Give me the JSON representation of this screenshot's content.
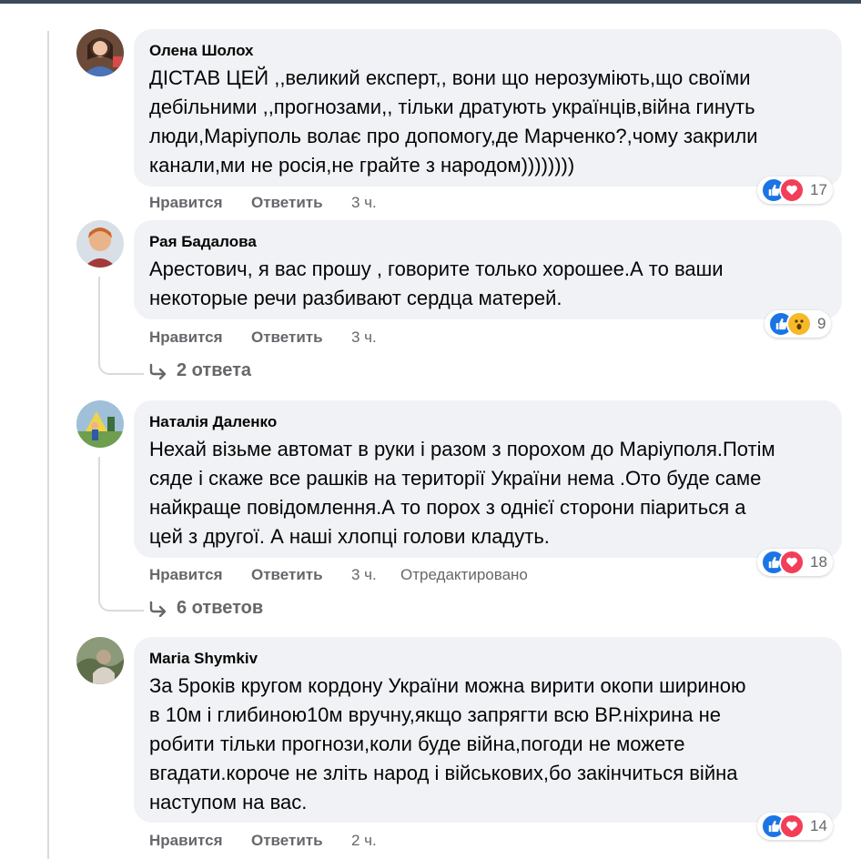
{
  "colors": {
    "bubble": "#f0f2f5",
    "secondary_text": "#65676b",
    "like": "#1b74e4",
    "love": "#f33e58",
    "wow": "#f7b928"
  },
  "comments": [
    {
      "author": "Олена Шолох",
      "lines": [
        "ДІСТАВ ЦЕЙ ,,великий експерт,, вони що нерозуміють,що своїми",
        "дебільними ,,прогнозами,, тільки дратують українців,війна гинуть",
        "люди,Маріуполь волає про допомогу,де Марченко?,чому закрили",
        "канали,ми не росія,не грайте з народом))))))))"
      ],
      "like_label": "Нравится",
      "reply_label": "Ответить",
      "time": "3 ч.",
      "reactions": [
        "like-icon",
        "love-icon"
      ],
      "reaction_count": "17"
    },
    {
      "author": "Рая Бадалова",
      "lines": [
        "Арестович, я вас прошу , говорите только хорошее.А то ваши",
        "некоторые речи разбивают сердца матерей."
      ],
      "like_label": "Нравится",
      "reply_label": "Ответить",
      "time": "3 ч.",
      "reactions": [
        "like-icon",
        "wow-icon"
      ],
      "reaction_count": "9",
      "replies_label": "2 ответа"
    },
    {
      "author": "Наталія Даленко",
      "lines": [
        "Нехай візьме автомат в руки і разом з порохом до Маріуполя.Потім",
        "сяде і скаже все рашків на території України нема .Ото буде саме",
        "найкраще повідомлення.А то порох з однієї сторони піариться а",
        "цей з другої. А наші хлопці голови кладуть."
      ],
      "like_label": "Нравится",
      "reply_label": "Ответить",
      "time": "3 ч.",
      "edited": "Отредактировано",
      "reactions": [
        "like-icon",
        "love-icon"
      ],
      "reaction_count": "18",
      "replies_label": "6 ответов"
    },
    {
      "author": "Maria Shymkiv",
      "lines": [
        "За 5років кругом кордону України можна вирити окопи шириною",
        "в 10м і глибиною10м вручну,якщо запрягти всю ВР.ніхрина не",
        "робити тільки прогнози,коли буде війна,погоди не можете",
        "вгадати.короче не зліть народ і військових,бо закінчиться війна",
        "наступом на вас."
      ],
      "like_label": "Нравится",
      "reply_label": "Ответить",
      "time": "2 ч.",
      "reactions": [
        "like-icon",
        "love-icon"
      ],
      "reaction_count": "14"
    }
  ]
}
